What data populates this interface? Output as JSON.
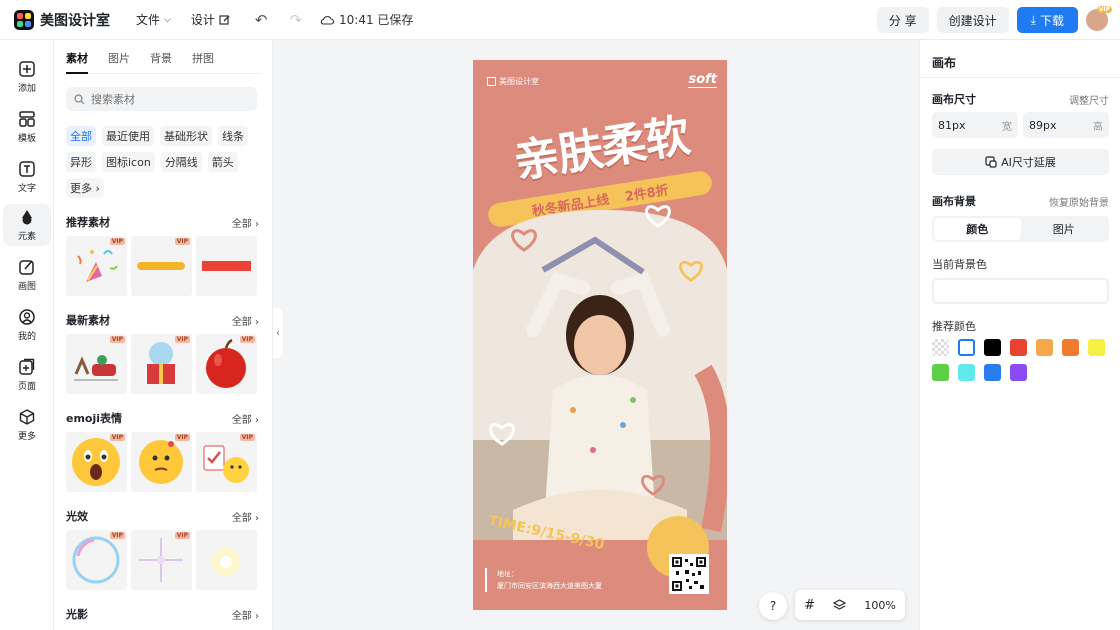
{
  "header": {
    "app_name": "美图设计室",
    "menu_file": "文件",
    "menu_design": "设计",
    "save_status": "10:41 已保存",
    "share_label": "分 享",
    "create_label": "创建设计",
    "download_label": "下载",
    "avatar_badge": "VIP"
  },
  "rail": [
    {
      "label": "添加",
      "icon": "plus-square-icon"
    },
    {
      "label": "模板",
      "icon": "template-icon"
    },
    {
      "label": "文字",
      "icon": "text-icon"
    },
    {
      "label": "元素",
      "icon": "shapes-icon"
    },
    {
      "label": "画图",
      "icon": "draw-icon"
    },
    {
      "label": "我的",
      "icon": "user-icon"
    },
    {
      "label": "页面",
      "icon": "page-icon"
    },
    {
      "label": "更多",
      "icon": "cube-icon"
    }
  ],
  "panel": {
    "tabs": [
      "素材",
      "图片",
      "背景",
      "拼图"
    ],
    "search_placeholder": "搜索素材",
    "chips": [
      "全部",
      "最近使用",
      "基础形状",
      "线条",
      "异形",
      "图标icon",
      "分隔线",
      "箭头",
      "更多"
    ],
    "see_all": "全部",
    "vip": "VIP",
    "sections": [
      "推荐素材",
      "最新素材",
      "emoji表情",
      "光效",
      "光影"
    ]
  },
  "poster": {
    "brand": "美图设计室",
    "soft": "soft",
    "headline": "亲肤柔软",
    "ribbon_left": "秋冬新品上线",
    "ribbon_right": "2件8折",
    "time": "TIME:9/15-9/30",
    "addr_label": "地址：",
    "addr_text": "厦门市同安区滨海西大道美图大厦"
  },
  "canvas_controls": {
    "help": "?",
    "zoom": "100%"
  },
  "right_panel": {
    "title": "画布",
    "size_label": "画布尺寸",
    "size_action": "调整尺寸",
    "width_value": "81px",
    "width_unit": "宽",
    "height_value": "89px",
    "height_unit": "高",
    "ai_button": "AI尺寸延展",
    "bg_label": "画布背景",
    "bg_reset": "恢复原始背景",
    "seg_color": "颜色",
    "seg_image": "图片",
    "current_bg": "当前背景色",
    "recommended": "推荐颜色",
    "swatches": [
      "transparent",
      "#ffffff",
      "#000000",
      "#e8432e",
      "#f4a84a",
      "#ef7b2d",
      "#f8ef45",
      "#5fcf48",
      "#61e9ee",
      "#2a7df0",
      "#8a4bf2"
    ]
  }
}
